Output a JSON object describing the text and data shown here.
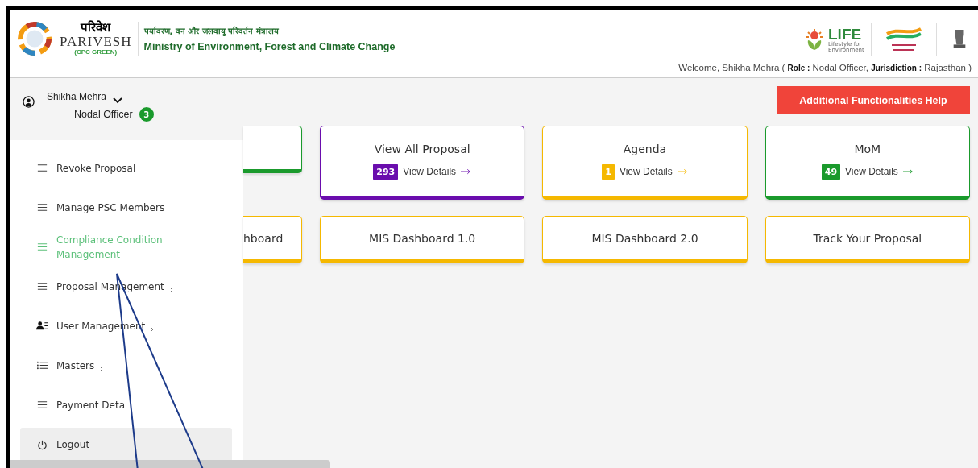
{
  "header": {
    "logo_hindi": "परिवेश",
    "logo_name": "PARIVESH",
    "logo_sub": "(CPC GREEN)",
    "ministry_hindi": "पर्यावरण, वन और जलवायु परिवर्तन मंत्रालय",
    "ministry": "Ministry of Environment, Forest and Climate Change",
    "life_logo": "LiFE",
    "life_sub": "Lifestyle for Environment",
    "welcome": "Welcome, Shikha Mehra ( **Role :** Nodal Officer,  **Jurisdiction :** Rajasthan )"
  },
  "user": {
    "name": "Shikha Mehra",
    "role": "Nodal Officer",
    "notifications": "3"
  },
  "sidebar": {
    "items": [
      {
        "label": "Revoke Proposal",
        "kind": "lines",
        "has_submenu": false,
        "selected": false
      },
      {
        "label": "Manage PSC Members",
        "kind": "lines",
        "has_submenu": false,
        "selected": false
      },
      {
        "label": "Compliance Condition Management",
        "kind": "lines",
        "has_submenu": false,
        "selected": true
      },
      {
        "label": "Proposal Management",
        "kind": "lines",
        "has_submenu": true,
        "selected": false
      },
      {
        "label": "User Management",
        "kind": "user",
        "has_submenu": true,
        "selected": false
      },
      {
        "label": "Masters",
        "kind": "list",
        "has_submenu": true,
        "selected": false
      },
      {
        "label": "Payment Deta",
        "kind": "lines",
        "has_submenu": false,
        "selected": false
      },
      {
        "label": "Logout",
        "kind": "power",
        "has_submenu": false,
        "selected": false
      }
    ]
  },
  "help_button": "Additional Functionalities Help",
  "cards": [
    {
      "color": "#1a9a2c"
    },
    {
      "title": "View All Proposal",
      "count": "293",
      "link": "View Details",
      "color": "#6a0dad"
    },
    {
      "title": "Agenda",
      "count": "1",
      "link": "View Details",
      "color": "#f5b800"
    },
    {
      "title": "MoM",
      "count": "49",
      "link": "View Details",
      "color": "#1a9a2c"
    },
    {
      "title": "hboard",
      "color": "#f5b800"
    },
    {
      "title": "MIS Dashboard 1.0",
      "color": "#f5b800"
    },
    {
      "title": "MIS Dashboard 2.0",
      "color": "#f5b800"
    },
    {
      "title": "Track Your Proposal",
      "color": "#f5b800"
    }
  ]
}
